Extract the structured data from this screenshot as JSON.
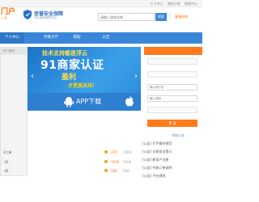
{
  "topbar": {
    "left_text": "",
    "links": [
      "个人中心",
      "我的订单",
      "帮助中心"
    ]
  },
  "brand": {
    "logo_text": "门户",
    "logo_sub": "一手",
    "shield_title": "信誉安全保障",
    "shield_sub": "专业游戏服务平台"
  },
  "search": {
    "placeholder": "请输入游戏名称",
    "button_label": "搜索"
  },
  "hotline": "客服热线",
  "nav": {
    "items": [
      "个人中心",
      "代练大厅",
      "帮助",
      "公告"
    ]
  },
  "side_panel": {
    "title": "热门游戏"
  },
  "banner": {
    "line1": "技术支持都是浮云",
    "line2": "91商家认证",
    "line3": "盈利",
    "line4": "才是真扶持!"
  },
  "app_download": {
    "label": "APP下载"
  },
  "login": {
    "title": "",
    "account_placeholder": "输入用户名",
    "password_placeholder": "输入密码",
    "button_label": "登 录"
  },
  "notice": {
    "title": "代练公告",
    "items": [
      "[公告] 打手操作规范",
      "[公告] 交易安全提示",
      "[公告] 新用户注册",
      "[公告] 代练订单说明",
      "[公告] 平台规则"
    ]
  },
  "orders": [
    {
      "name": "3三有",
      "price": "370",
      "old": "1500"
    },
    {
      "name": "-32",
      "price": "1500",
      "old": "1500"
    },
    {
      "name": "-42",
      "price": "500",
      "old": "500"
    }
  ],
  "colors": {
    "nav_blue": "#3a87d9",
    "accent_orange": "#ff7a1a"
  }
}
